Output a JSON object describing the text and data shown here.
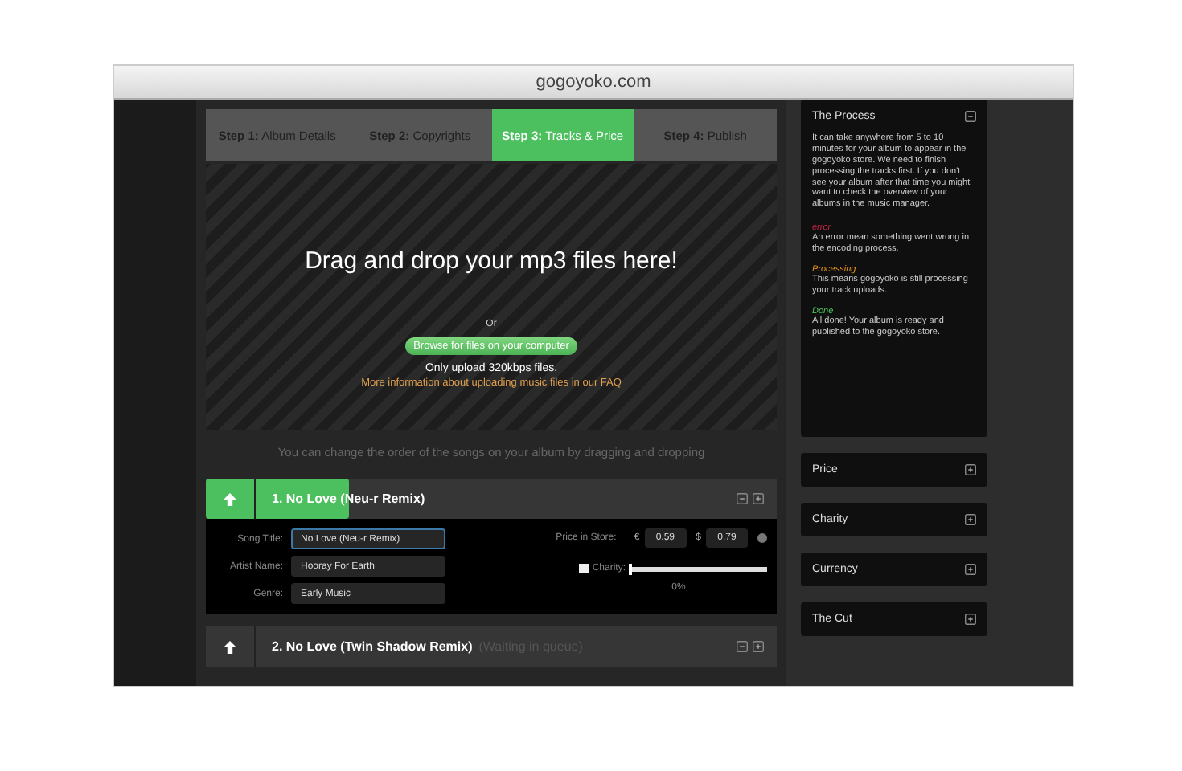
{
  "window": {
    "title": "gogoyoko.com"
  },
  "steps": [
    {
      "label": "**Step 1:** Album Details",
      "selected": false
    },
    {
      "label": "**Step 2:** Copyrights",
      "selected": false
    },
    {
      "label": "**Step 3:** Tracks & Price",
      "selected": true
    },
    {
      "label": "**Step 4:** Publish",
      "selected": false
    }
  ],
  "dropzone": {
    "heading": "Drag and drop your mp3 files here!",
    "or": "Or",
    "button": "Browse for files on your computer",
    "note": "Only upload 320kbps files.",
    "link": "More information about uploading music files in our FAQ"
  },
  "hint": "You can change the order of the songs on your album by dragging and dropping",
  "tracks": [
    {
      "title": "1. No Love (Neu-r Remix)",
      "level": 0.25,
      "fields": [
        {
          "label": "Song Title:",
          "value": "No Love (Neu-r Remix)",
          "focused": true
        },
        {
          "label": "Artist Name:",
          "value": "Hooray For Earth",
          "focused": false
        },
        {
          "label": "Genre:",
          "value": "Early Music",
          "focused": false
        }
      ],
      "price": {
        "label": "Price in Store:",
        "euro_sign": "€",
        "euro": "0.59",
        "dollar_sign": "$",
        "dollar": "0.79"
      },
      "charity": {
        "label": "Charity:",
        "checked": false,
        "level": 0,
        "reading": "0%"
      }
    },
    {
      "title": "2. No Love (Twin Shadow Remix)",
      "status": "(Waiting in queue)"
    }
  ],
  "sidebar": [
    {
      "title": "The Process",
      "expanded": true,
      "intro": "It can take anywhere from 5 to 10 minutes for your album to appear in the gogoyoko store. We need to finish processing the tracks first. If you don't see your album after that time you might want to check the overview of your albums in the music manager.",
      "statuses": [
        {
          "name": "error",
          "color": "#d0234a",
          "text": "An error mean something went wrong in the encoding process."
        },
        {
          "name": "Processing",
          "color": "#e8931e",
          "text": "This means gogoyoko is still processing your track uploads."
        },
        {
          "name": "Done",
          "color": "#4cc85a",
          "text": "All done! Your album is ready and published to the gogoyoko store."
        }
      ]
    },
    {
      "title": "Price",
      "expanded": false
    },
    {
      "title": "Charity",
      "expanded": false
    },
    {
      "title": "Currency",
      "expanded": false
    },
    {
      "title": "The Cut",
      "expanded": false
    }
  ]
}
